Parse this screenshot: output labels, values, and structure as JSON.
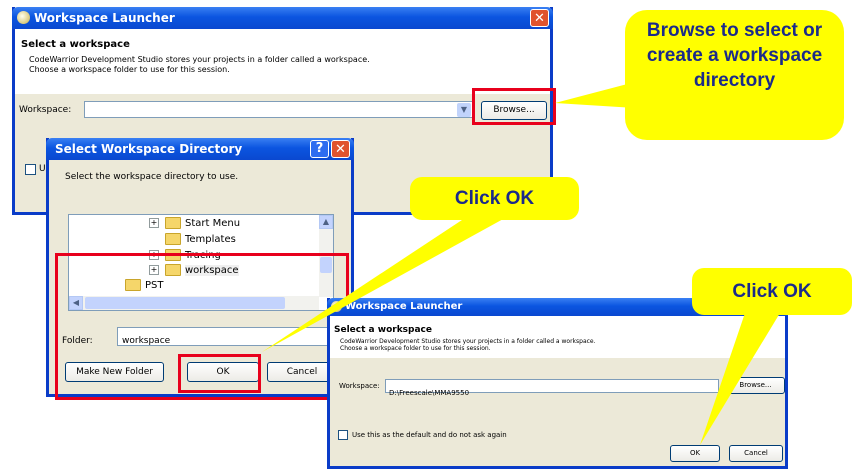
{
  "launcher1": {
    "title": "Workspace Launcher",
    "heading": "Select a workspace",
    "desc_line1": "CodeWarrior Development Studio stores your projects in a folder called a workspace.",
    "desc_line2": "Choose a workspace folder to use for this session.",
    "workspace_label": "Workspace:",
    "workspace_value": "",
    "browse_label": "Browse...",
    "checkbox_label_partial": "Us"
  },
  "dir_dialog": {
    "title": "Select Workspace Directory",
    "prompt": "Select the workspace directory to use.",
    "tree_items": [
      {
        "label": "Start Menu",
        "expander": "+"
      },
      {
        "label": "Templates",
        "expander": ""
      },
      {
        "label": "Tracing",
        "expander": "+"
      },
      {
        "label": "workspace",
        "expander": "+"
      },
      {
        "label": "PST",
        "expander": ""
      }
    ],
    "folder_label": "Folder:",
    "folder_value": "workspace",
    "make_new_folder_label": "Make New Folder",
    "ok_label": "OK",
    "cancel_label": "Cancel"
  },
  "launcher2": {
    "title": "Workspace Launcher",
    "heading": "Select a workspace",
    "desc_line1": "CodeWarrior Development Studio stores your projects in a folder called a workspace.",
    "desc_line2": "Choose a workspace folder to use for this session.",
    "workspace_label": "Workspace:",
    "workspace_value": "D:\\Freescale\\MMA9550",
    "browse_label": "Browse...",
    "checkbox_label": "Use this as the default and do not ask again",
    "ok_label": "OK",
    "cancel_label": "Cancel"
  },
  "callouts": {
    "browse": "Browse to select or create a workspace directory",
    "click_ok_1": "Click OK",
    "click_ok_2": "Click OK"
  },
  "colors": {
    "callout_bg": "#ffff00",
    "callout_text": "#1b2a8a",
    "highlight": "#e8001c",
    "xp_title": "#0b55e0"
  }
}
